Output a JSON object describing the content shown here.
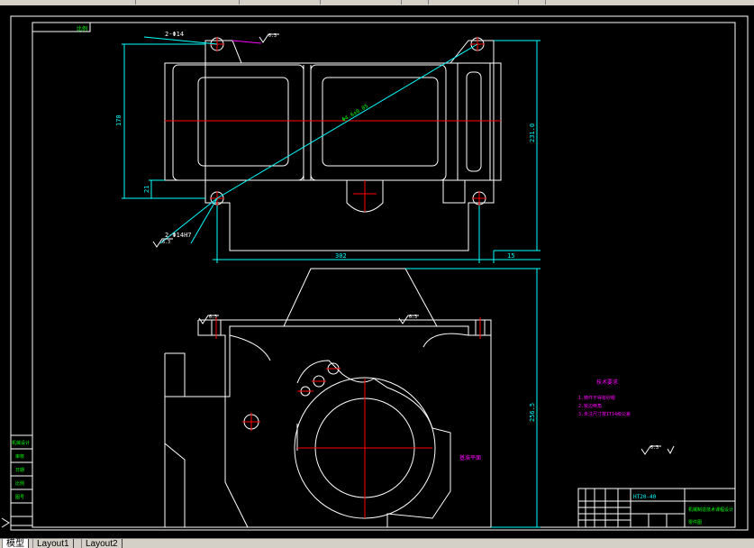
{
  "toolbar": {},
  "drawing": {
    "label_top_left": "比例",
    "note_holes_top": "2-Φ14",
    "note_holes_bottom": "2-Φ14H7",
    "roughness_top": "6.3",
    "roughness_bottom": "6.3",
    "roughness_mid_left": "6.3",
    "roughness_mid_right": "6.3",
    "roughness_right": "6.3",
    "dim_170": "170",
    "dim_21": "21",
    "dim_302": "302",
    "dim_15": "15",
    "dim_231": "231.0",
    "dim_256": "256.5",
    "dim_diagonal": "Φ4.6±0.05",
    "tech_req_title": "技术要求",
    "tech_req_lines": [
      "1.铸件不得有砂眼",
      "2.锐边倒角",
      "3.未注尺寸按IT14级公差"
    ],
    "section_label": "基准平面",
    "title_block_name": "HT20-40",
    "title_block_desc": "机械制造技术课程设计",
    "title_block_part": "零件图",
    "legend_left": [
      "机械设计",
      "审核",
      "日期",
      "比例",
      "图号"
    ]
  },
  "tabs": {
    "model": "模型",
    "layout1": "Layout1",
    "layout2": "Layout2"
  },
  "colors": {
    "background": "#000000",
    "outline": "#ffffff",
    "dimension": "#00ffff",
    "centerline": "#ff0000",
    "text_green": "#00ff00",
    "text_magenta": "#ff00ff"
  }
}
